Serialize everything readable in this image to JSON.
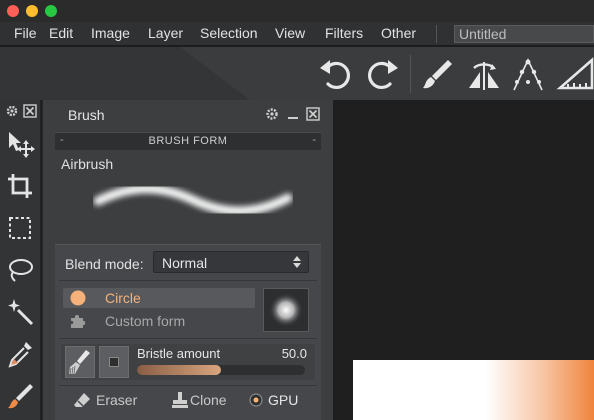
{
  "window": {
    "title_field": "Untitled"
  },
  "menu": [
    "File",
    "Edit",
    "Image",
    "Layer",
    "Selection",
    "View",
    "Filters",
    "Other"
  ],
  "toolbar": {
    "buttons": [
      "undo-icon",
      "redo-icon",
      "brush-tool-icon",
      "mirror-symmetry-icon",
      "perspective-icon",
      "ruler-icon"
    ]
  },
  "tools": [
    "move-icon",
    "crop-icon",
    "rect-select-icon",
    "lasso-icon",
    "magic-wand-icon",
    "eyedropper-icon",
    "brush-icon"
  ],
  "brush_panel": {
    "title": "Brush",
    "section": "BRUSH FORM",
    "brush_name": "Airbrush",
    "blend_label": "Blend mode:",
    "blend_value": "Normal",
    "forms": [
      {
        "label": "Circle",
        "selected": true
      },
      {
        "label": "Custom form",
        "selected": false
      }
    ],
    "bristle": {
      "label": "Bristle amount",
      "value": "50.0",
      "fraction": 0.5
    },
    "bottom": {
      "eraser": "Eraser",
      "clone": "Clone",
      "gpu": "GPU"
    }
  },
  "colors": {
    "accent": "#f0843c",
    "circle_dot": "#f6b27a"
  }
}
